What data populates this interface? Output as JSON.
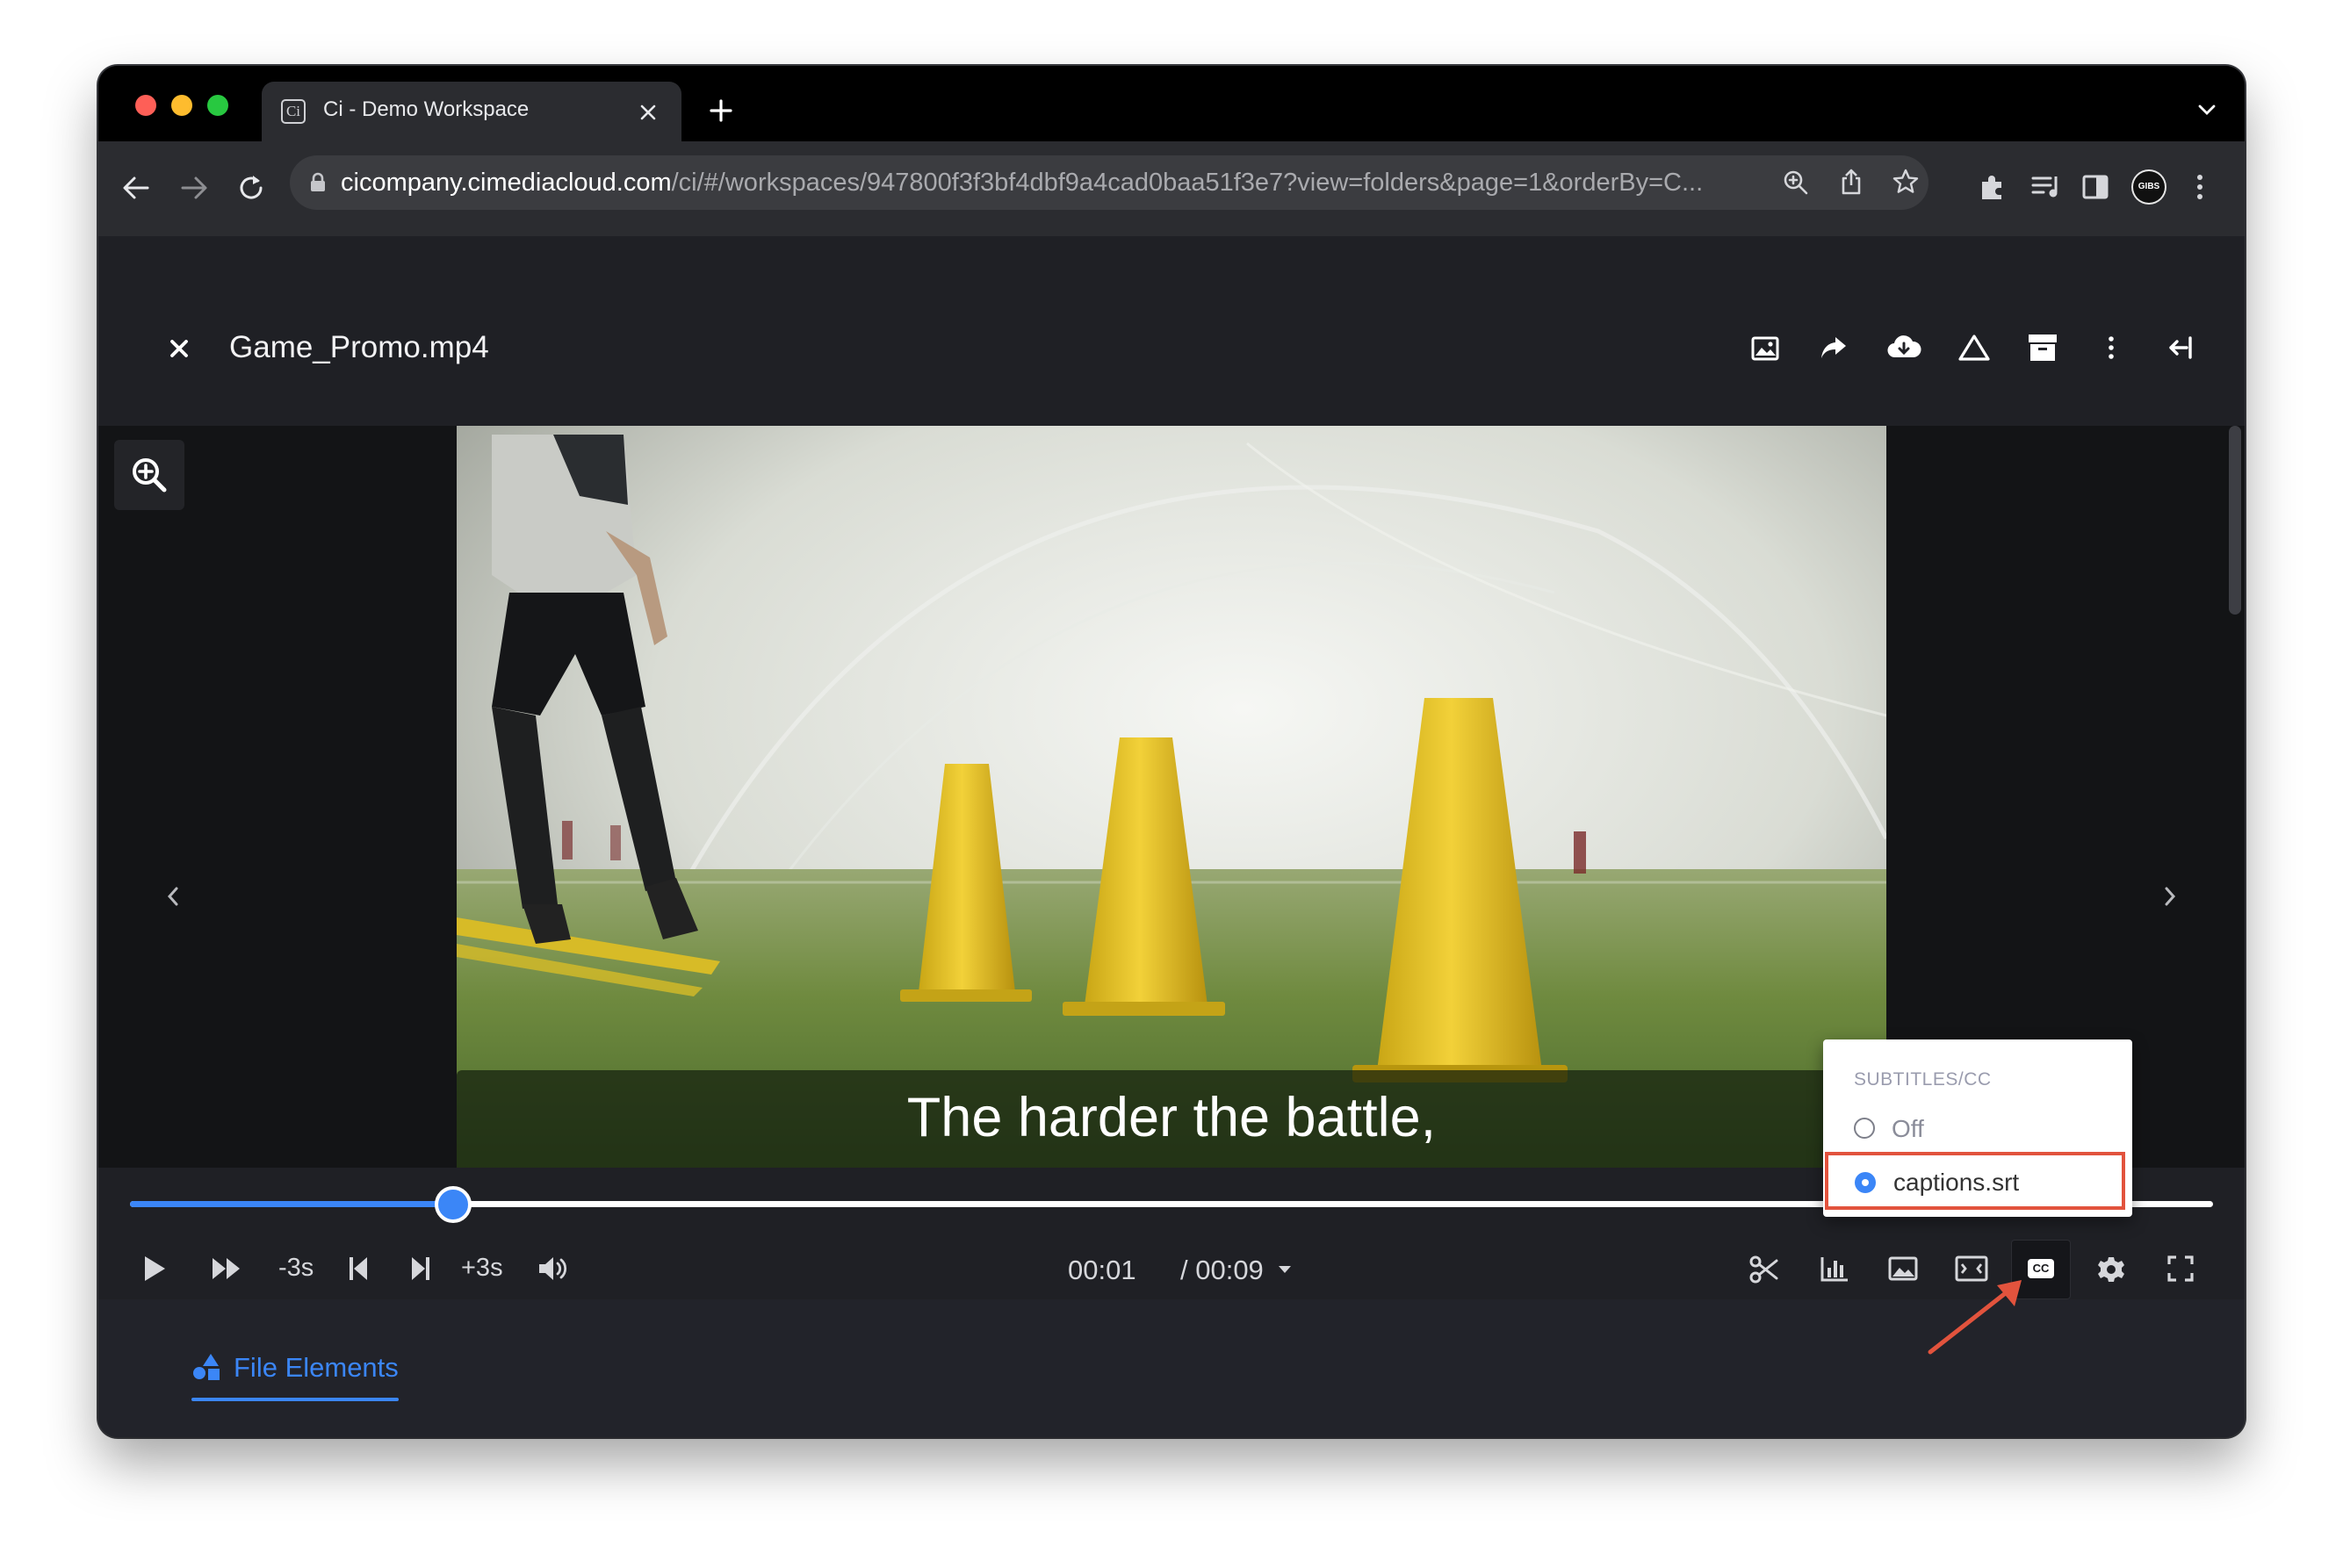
{
  "browser": {
    "tab_title": "Ci - Demo Workspace",
    "tab_favicon": "Ci",
    "url_domain": "cicompany.cimediacloud.com",
    "url_path": "/ci/#/workspaces/947800f3f3bf4dbf9a4cad0baa51f3e7?view=folders&page=1&orderBy=C...",
    "profile_badge": "GIBS"
  },
  "header": {
    "filename": "Game_Promo.mp4"
  },
  "video": {
    "subtitle_text": "The harder the battle,"
  },
  "player": {
    "progress_fraction": 0.155,
    "back_label": "-3s",
    "forward_label": "+3s",
    "current_time": "00:01",
    "duration": "/ 00:09",
    "cc_label": "CC"
  },
  "subtitles_menu": {
    "title": "SUBTITLES/CC",
    "options": [
      "Off",
      "captions.srt"
    ],
    "selected": "captions.srt"
  },
  "bottom_tabs": {
    "file_elements": "File Elements"
  },
  "colors": {
    "accent": "#3b86f7",
    "highlight_box": "#e2533d",
    "window_bg": "#1f2025"
  }
}
